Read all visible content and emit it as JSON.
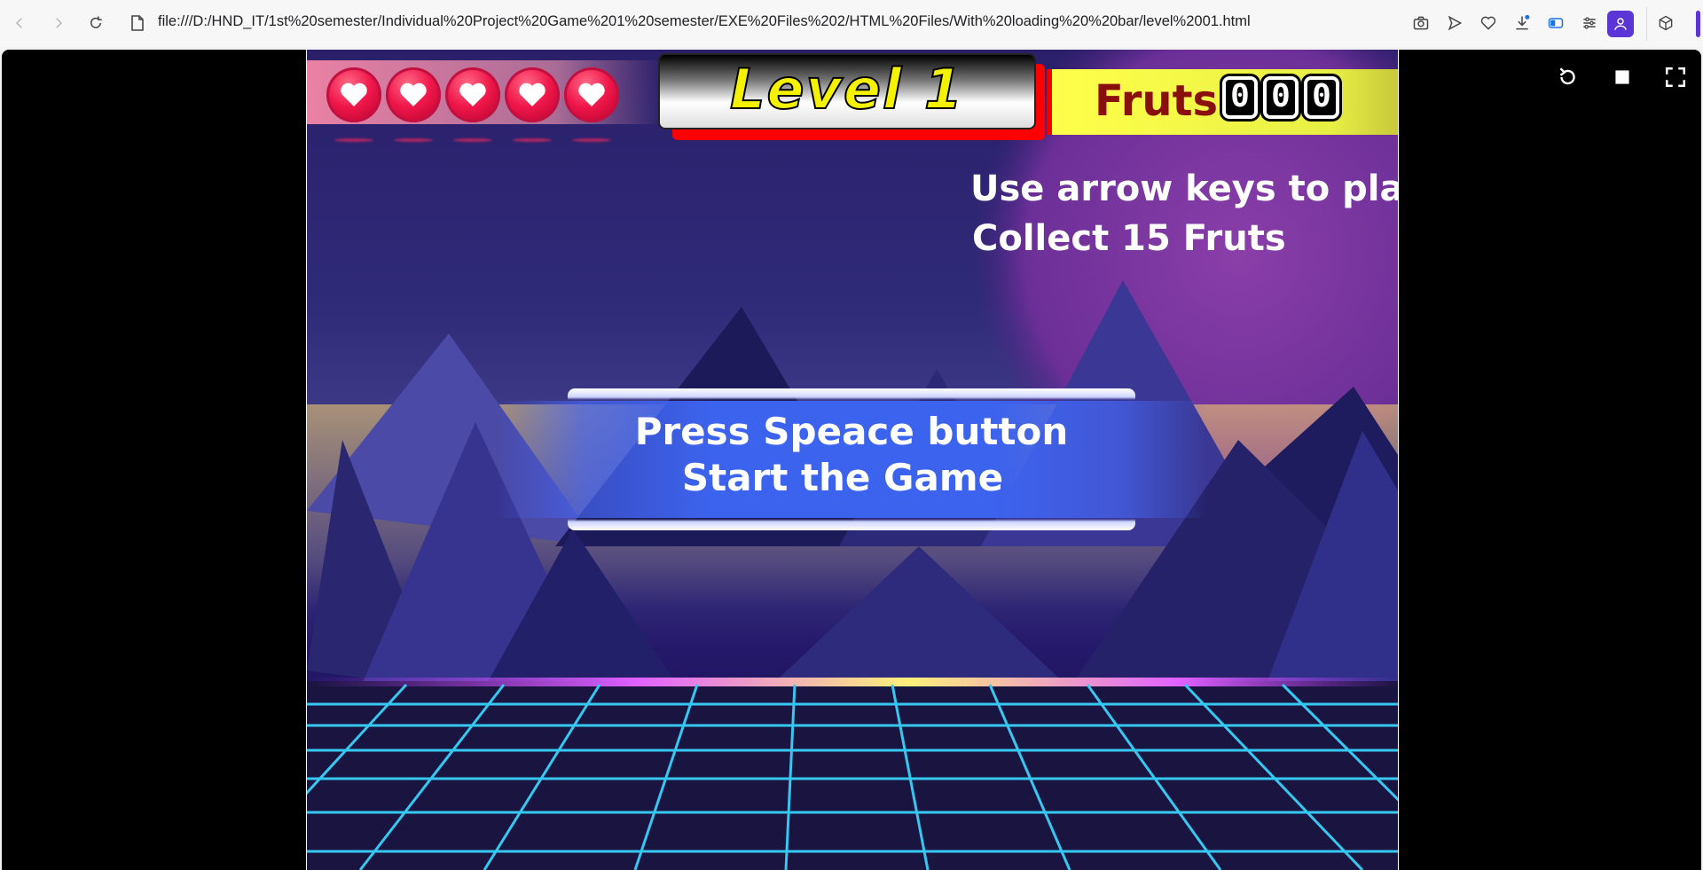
{
  "browser": {
    "url": "file:///D:/HND_IT/1st%20semester/Individual%20Project%20Game%201%20semester/EXE%20Files%202/HTML%20Files/With%20loading%20%20bar/level%2001.html"
  },
  "game": {
    "hearts": {
      "count": 5
    },
    "level": {
      "title": "Level 1"
    },
    "fruits": {
      "label": "Fruts",
      "digits": [
        "0",
        "0",
        "0"
      ]
    },
    "instructions": {
      "line1": "Use arrow keys to play",
      "line2": "Collect 15 Fruts"
    },
    "start_banner": {
      "line1": "Press Speace button",
      "line2": "Start the Game"
    }
  },
  "colors": {
    "accent": "#5b35d5",
    "level_text": "#f4f200",
    "fruit_label": "#8a1010",
    "grid": "#35c8f0",
    "banner": "#3c63ee"
  }
}
